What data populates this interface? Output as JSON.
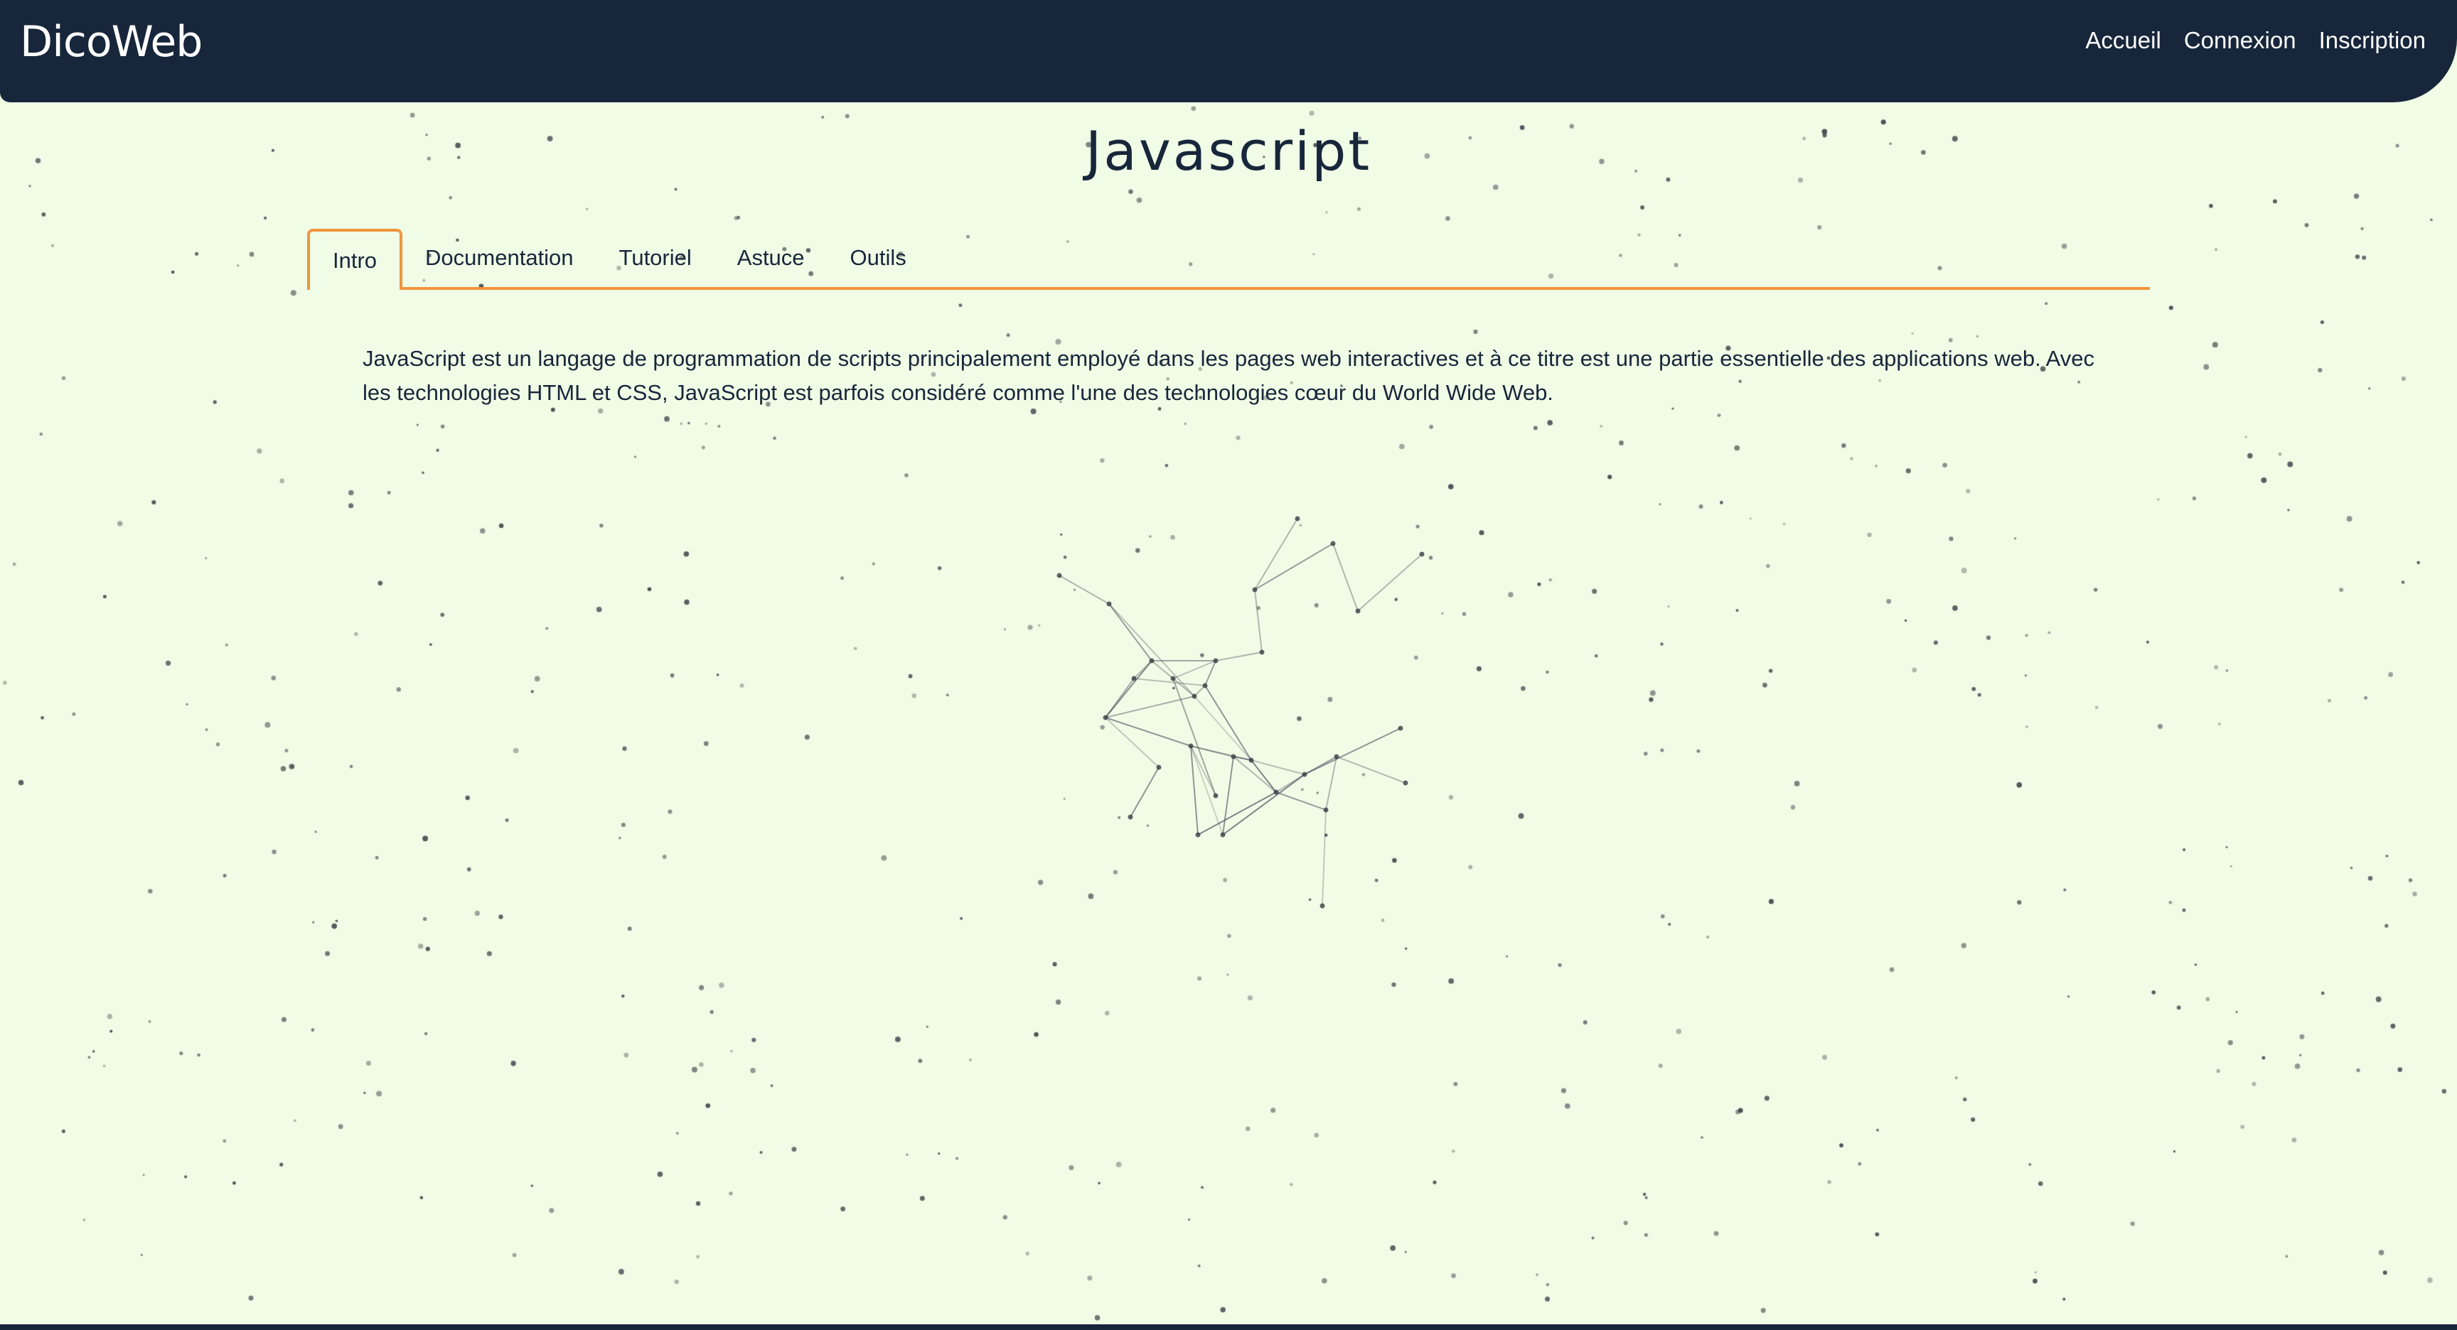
{
  "header": {
    "brand": "DicoWeb",
    "nav": [
      {
        "label": "Accueil"
      },
      {
        "label": "Connexion"
      },
      {
        "label": "Inscription"
      }
    ]
  },
  "page": {
    "title": "Javascript",
    "tabs": [
      {
        "label": "Intro",
        "active": true
      },
      {
        "label": "Documentation",
        "active": false
      },
      {
        "label": "Tutoriel",
        "active": false
      },
      {
        "label": "Astuce",
        "active": false
      },
      {
        "label": "Outils",
        "active": false
      }
    ],
    "intro_text": "JavaScript est un langage de programmation de scripts principalement employé dans les pages web interactives et à ce titre est une partie essentielle des applications web. Avec les technologies HTML et CSS, JavaScript est parfois considéré comme l'une des technologies cœur du World Wide Web."
  },
  "colors": {
    "background": "#f0fce6",
    "navbar": "#17263a",
    "accent": "#f0953d",
    "text": "#17263a",
    "particles": "#3a3f45"
  }
}
